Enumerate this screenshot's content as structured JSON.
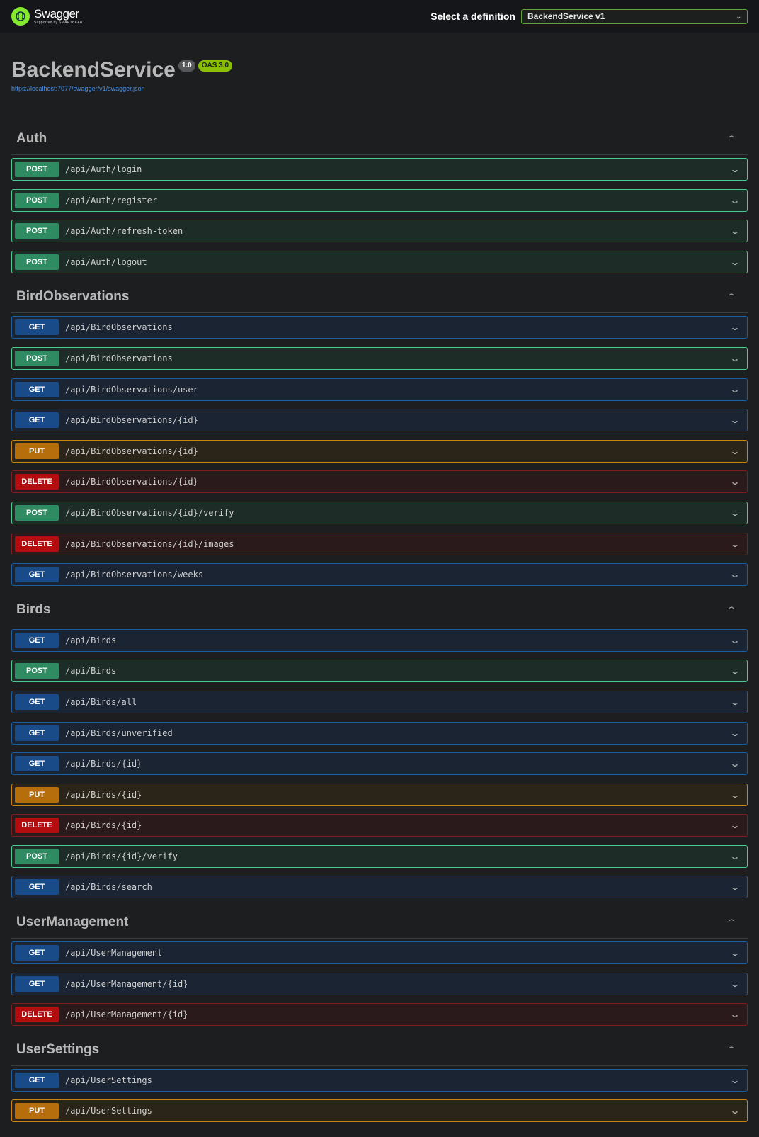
{
  "header": {
    "brand": "Swagger",
    "brand_sub": "Supported by SMARTBEAR",
    "select_label": "Select a definition",
    "selected_definition": "BackendService v1"
  },
  "info": {
    "title": "BackendService",
    "version": "1.0",
    "oas": "OAS 3.0",
    "spec_url": "https://localhost:7077/swagger/v1/swagger.json"
  },
  "colors": {
    "post": "#49cc90",
    "get": "#1e5ea0",
    "put": "#c7860f",
    "delete": "#b30d10",
    "brand": "#85ea2d"
  },
  "tags": [
    {
      "name": "Auth",
      "operations": [
        {
          "method": "POST",
          "path": "/api/Auth/login"
        },
        {
          "method": "POST",
          "path": "/api/Auth/register"
        },
        {
          "method": "POST",
          "path": "/api/Auth/refresh-token"
        },
        {
          "method": "POST",
          "path": "/api/Auth/logout"
        }
      ]
    },
    {
      "name": "BirdObservations",
      "operations": [
        {
          "method": "GET",
          "path": "/api/BirdObservations"
        },
        {
          "method": "POST",
          "path": "/api/BirdObservations"
        },
        {
          "method": "GET",
          "path": "/api/BirdObservations/user"
        },
        {
          "method": "GET",
          "path": "/api/BirdObservations/{id}"
        },
        {
          "method": "PUT",
          "path": "/api/BirdObservations/{id}"
        },
        {
          "method": "DELETE",
          "path": "/api/BirdObservations/{id}"
        },
        {
          "method": "POST",
          "path": "/api/BirdObservations/{id}/verify"
        },
        {
          "method": "DELETE",
          "path": "/api/BirdObservations/{id}/images"
        },
        {
          "method": "GET",
          "path": "/api/BirdObservations/weeks"
        }
      ]
    },
    {
      "name": "Birds",
      "operations": [
        {
          "method": "GET",
          "path": "/api/Birds"
        },
        {
          "method": "POST",
          "path": "/api/Birds"
        },
        {
          "method": "GET",
          "path": "/api/Birds/all"
        },
        {
          "method": "GET",
          "path": "/api/Birds/unverified"
        },
        {
          "method": "GET",
          "path": "/api/Birds/{id}"
        },
        {
          "method": "PUT",
          "path": "/api/Birds/{id}"
        },
        {
          "method": "DELETE",
          "path": "/api/Birds/{id}"
        },
        {
          "method": "POST",
          "path": "/api/Birds/{id}/verify"
        },
        {
          "method": "GET",
          "path": "/api/Birds/search"
        }
      ]
    },
    {
      "name": "UserManagement",
      "operations": [
        {
          "method": "GET",
          "path": "/api/UserManagement"
        },
        {
          "method": "GET",
          "path": "/api/UserManagement/{id}"
        },
        {
          "method": "DELETE",
          "path": "/api/UserManagement/{id}"
        }
      ]
    },
    {
      "name": "UserSettings",
      "operations": [
        {
          "method": "GET",
          "path": "/api/UserSettings"
        },
        {
          "method": "PUT",
          "path": "/api/UserSettings"
        }
      ]
    }
  ]
}
